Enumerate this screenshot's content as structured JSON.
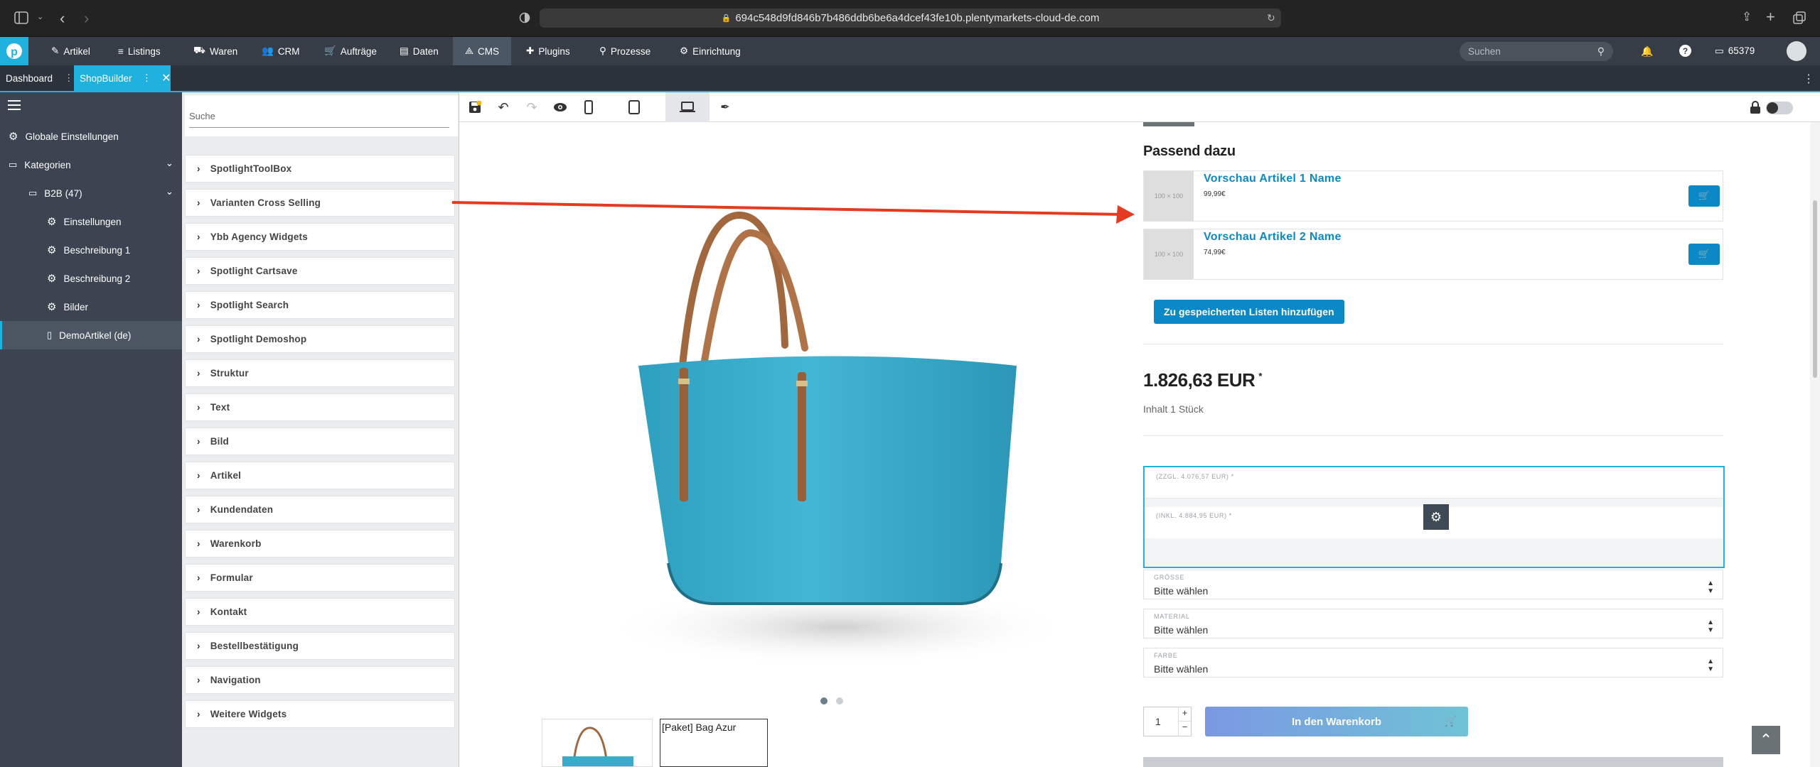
{
  "browser": {
    "url": "694c548d9fd846b7b486ddb6be6a4dcef43fe10b.plentymarkets-cloud-de.com"
  },
  "nav": {
    "items": [
      {
        "label": "Artikel"
      },
      {
        "label": "Listings"
      },
      {
        "label": "Waren"
      },
      {
        "label": "CRM"
      },
      {
        "label": "Aufträge"
      },
      {
        "label": "Daten"
      },
      {
        "label": "CMS"
      },
      {
        "label": "Plugins"
      },
      {
        "label": "Prozesse"
      },
      {
        "label": "Einrichtung"
      }
    ],
    "search_placeholder": "Suchen",
    "account_id": "65379"
  },
  "tabs": {
    "dashboard": "Dashboard",
    "shopbuilder": "ShopBuilder"
  },
  "sidebar": {
    "items": [
      {
        "label": "Globale Einstellungen"
      },
      {
        "label": "Kategorien"
      },
      {
        "label": "B2B (47)"
      },
      {
        "label": "Einstellungen"
      },
      {
        "label": "Beschreibung 1"
      },
      {
        "label": "Beschreibung 2"
      },
      {
        "label": "Bilder"
      },
      {
        "label": "DemoArtikel (de)"
      }
    ]
  },
  "widgets": {
    "search_placeholder": "Suche",
    "items": [
      {
        "label": "SpotlightToolBox"
      },
      {
        "label": "Varianten Cross Selling"
      },
      {
        "label": "Ybb Agency Widgets"
      },
      {
        "label": "Spotlight Cartsave"
      },
      {
        "label": "Spotlight Search"
      },
      {
        "label": "Spotlight Demoshop"
      },
      {
        "label": "Struktur"
      },
      {
        "label": "Text"
      },
      {
        "label": "Bild"
      },
      {
        "label": "Artikel"
      },
      {
        "label": "Kundendaten"
      },
      {
        "label": "Warenkorb"
      },
      {
        "label": "Formular"
      },
      {
        "label": "Kontakt"
      },
      {
        "label": "Bestellbestätigung"
      },
      {
        "label": "Navigation"
      },
      {
        "label": "Weitere Widgets"
      }
    ]
  },
  "preview": {
    "section_title": "Passend dazu",
    "cross_items": [
      {
        "placeholder": "100 × 100",
        "name": "Vorschau Artikel 1 Name",
        "price": "99,99€"
      },
      {
        "placeholder": "100 × 100",
        "name": "Vorschau Artikel 2 Name",
        "price": "74,99€"
      }
    ],
    "wishlist_button": "Zu gespeicherten Listen hinzufügen",
    "price": "1.826,63 EUR",
    "price_star": "*",
    "content": "Inhalt 1 Stück",
    "net_price": "(ZZGL. 4.076,57 EUR) *",
    "gross_price": "(INKL. 4.884,95 EUR) *",
    "selects": [
      {
        "label": "GRÖSSE",
        "value": "Bitte wählen"
      },
      {
        "label": "MATERIAL",
        "value": "Bitte wählen"
      },
      {
        "label": "FARBE",
        "value": "Bitte wählen"
      }
    ],
    "quantity": "1",
    "cart_button": "In den Warenkorb",
    "thumb_caption": "[Paket] Bag Azur"
  },
  "colors": {
    "accent": "#1fb2de",
    "link": "#0b88c6",
    "button": "#0b88c6",
    "arrow": "#e53a1f",
    "bag": "#3aaccb"
  }
}
